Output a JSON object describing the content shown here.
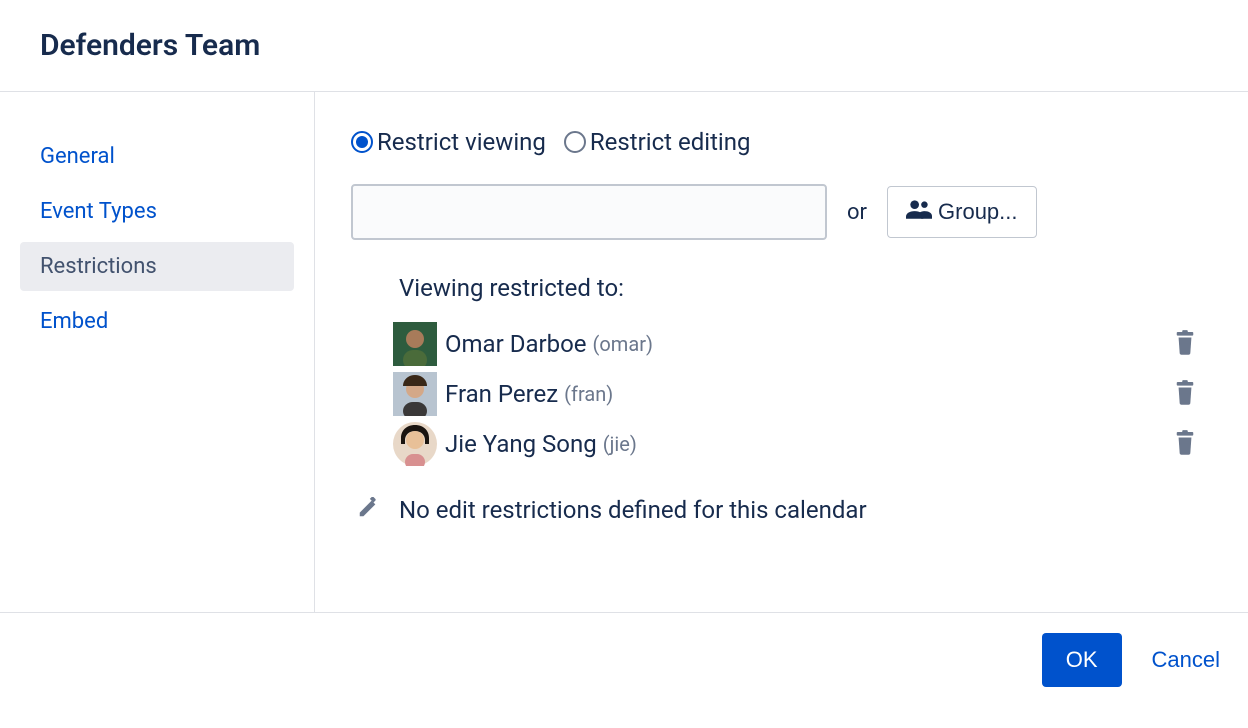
{
  "header": {
    "title": "Defenders Team"
  },
  "sidebar": {
    "items": [
      {
        "label": "General",
        "active": false
      },
      {
        "label": "Event Types",
        "active": false
      },
      {
        "label": "Restrictions",
        "active": true
      },
      {
        "label": "Embed",
        "active": false
      }
    ]
  },
  "main": {
    "radios": {
      "viewing": "Restrict viewing",
      "editing": "Restrict editing"
    },
    "or_label": "or",
    "group_button": "Group...",
    "section_heading": "Viewing restricted to:",
    "users": [
      {
        "name": "Omar Darboe",
        "handle": "(omar)"
      },
      {
        "name": "Fran Perez",
        "handle": "(fran)"
      },
      {
        "name": "Jie Yang Song",
        "handle": "(jie)"
      }
    ],
    "edit_note": "No edit restrictions defined for this calendar"
  },
  "footer": {
    "ok": "OK",
    "cancel": "Cancel"
  }
}
